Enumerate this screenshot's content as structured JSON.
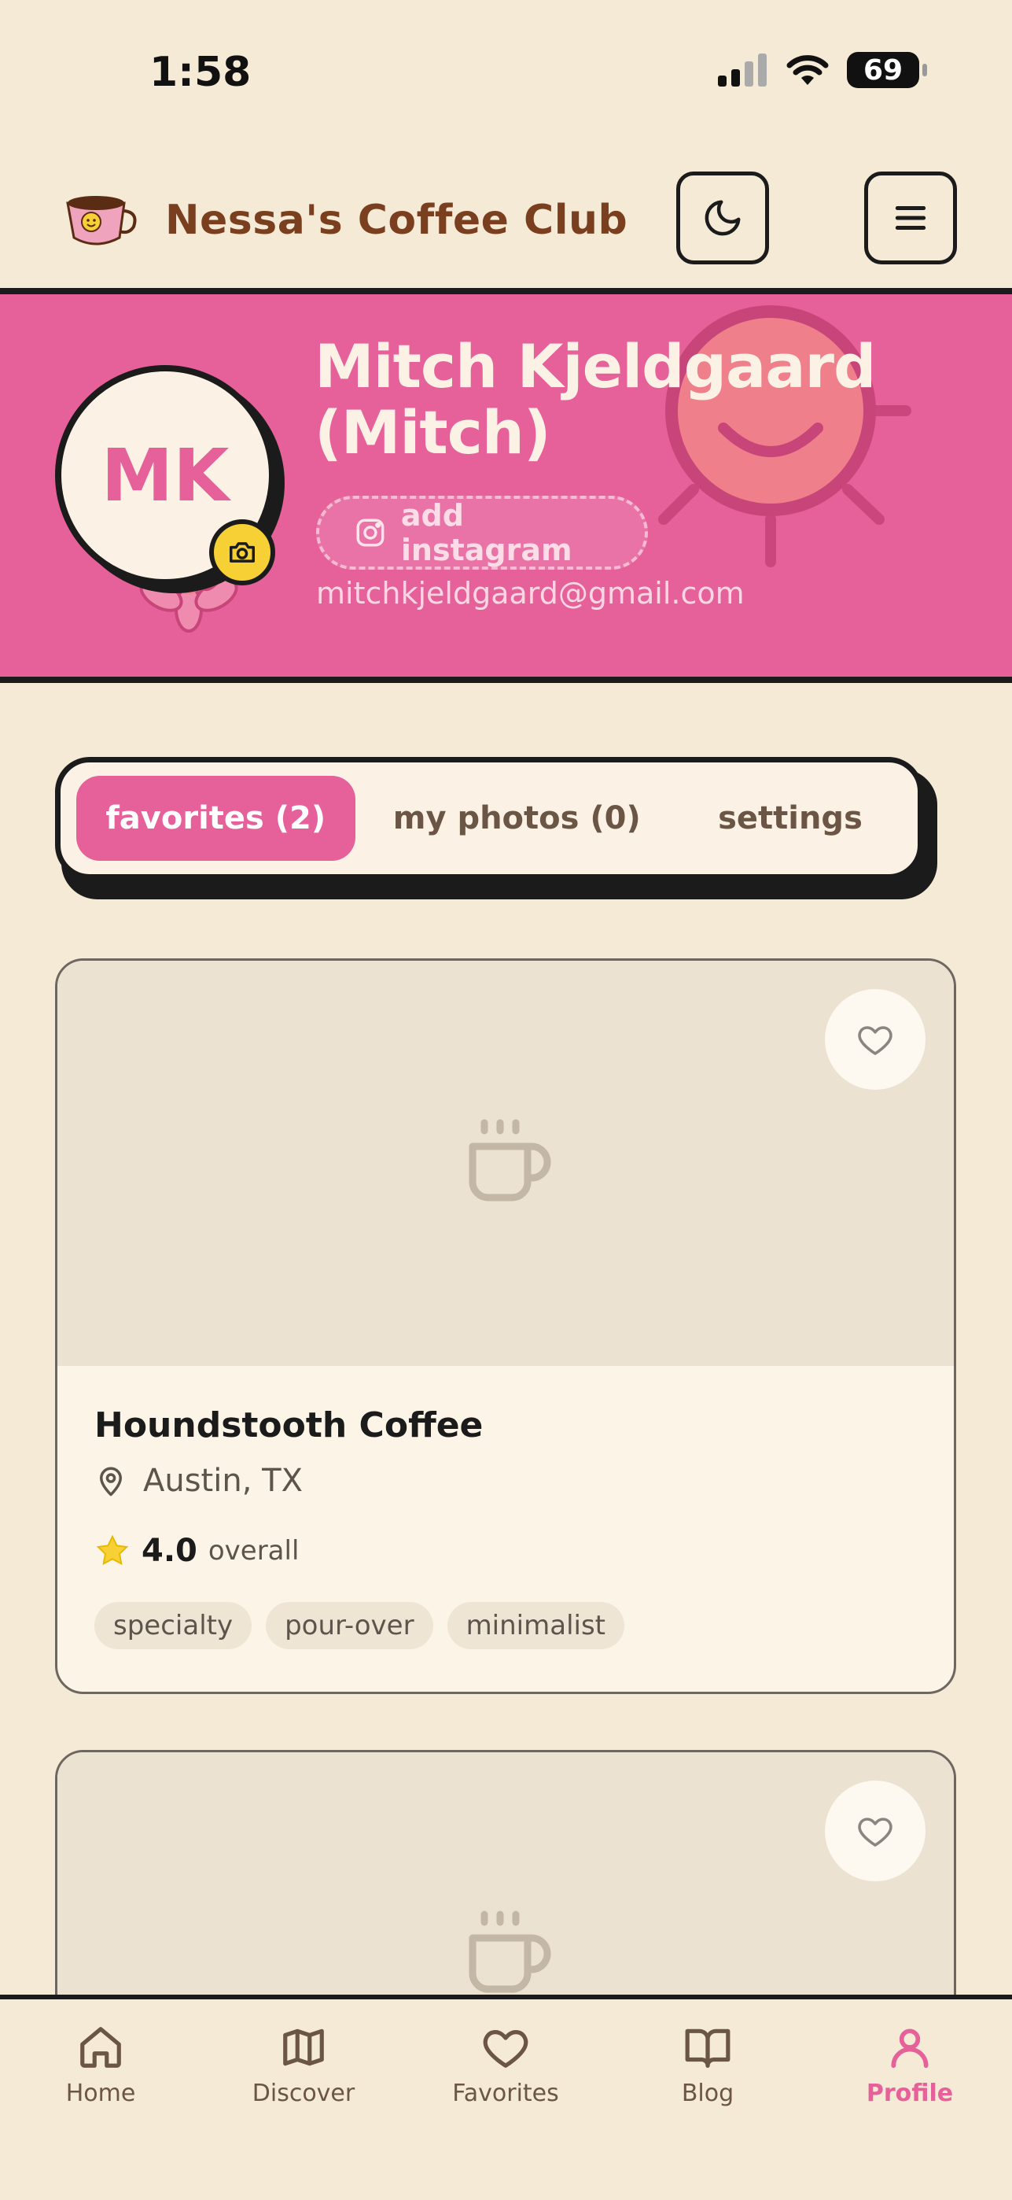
{
  "status_bar": {
    "time": "1:58",
    "battery": "69"
  },
  "header": {
    "app_title": "Nessa's Coffee Club"
  },
  "profile": {
    "initials": "MK",
    "name": "Mitch Kjeldgaard (Mitch)",
    "instagram_button": "add instagram",
    "email": "mitchkjeldgaard@gmail.com"
  },
  "tabs": [
    {
      "label": "favorites (2)",
      "active": true
    },
    {
      "label": "my photos (0)",
      "active": false
    },
    {
      "label": "settings",
      "active": false
    }
  ],
  "cards": [
    {
      "name": "Houndstooth Coffee",
      "location": "Austin, TX",
      "rating": "4.0",
      "rating_label": "overall",
      "tags": [
        "specialty",
        "pour-over",
        "minimalist"
      ]
    }
  ],
  "bottom_nav": [
    {
      "label": "Home",
      "icon": "home-icon"
    },
    {
      "label": "Discover",
      "icon": "map-icon"
    },
    {
      "label": "Favorites",
      "icon": "heart-icon"
    },
    {
      "label": "Blog",
      "icon": "book-icon"
    },
    {
      "label": "Profile",
      "icon": "user-icon",
      "active": true
    }
  ],
  "colors": {
    "accent": "#e6609a",
    "background": "#f5ead6",
    "brand_text": "#7a3f1e",
    "highlight": "#f6d034"
  }
}
